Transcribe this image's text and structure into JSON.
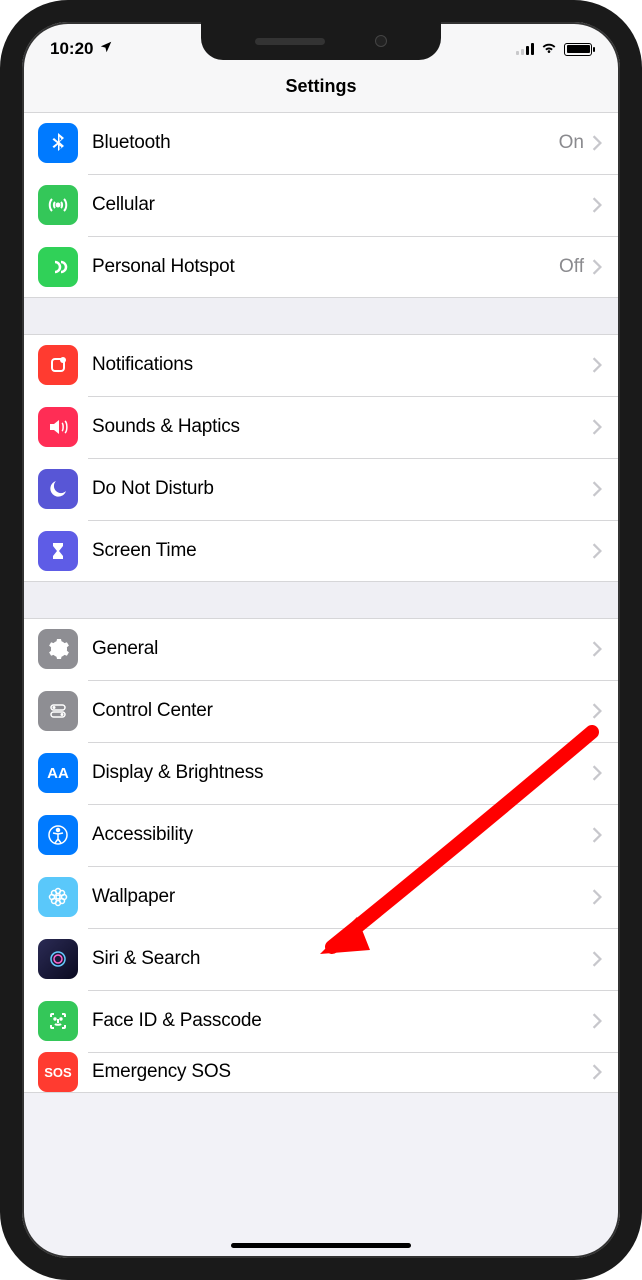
{
  "statusbar": {
    "time": "10:20"
  },
  "header": {
    "title": "Settings"
  },
  "groups": [
    {
      "rows": [
        {
          "id": "bluetooth",
          "label": "Bluetooth",
          "value": "On",
          "icon": "bluetooth",
          "color": "bg-blue"
        },
        {
          "id": "cellular",
          "label": "Cellular",
          "value": "",
          "icon": "antenna",
          "color": "bg-green"
        },
        {
          "id": "hotspot",
          "label": "Personal Hotspot",
          "value": "Off",
          "icon": "link",
          "color": "bg-green2"
        }
      ]
    },
    {
      "rows": [
        {
          "id": "notifications",
          "label": "Notifications",
          "value": "",
          "icon": "bell",
          "color": "bg-red"
        },
        {
          "id": "sounds",
          "label": "Sounds & Haptics",
          "value": "",
          "icon": "speaker",
          "color": "bg-red2"
        },
        {
          "id": "dnd",
          "label": "Do Not Disturb",
          "value": "",
          "icon": "moon",
          "color": "bg-purple"
        },
        {
          "id": "screentime",
          "label": "Screen Time",
          "value": "",
          "icon": "hourglass",
          "color": "bg-purple2"
        }
      ]
    },
    {
      "rows": [
        {
          "id": "general",
          "label": "General",
          "value": "",
          "icon": "gear",
          "color": "bg-gray"
        },
        {
          "id": "controlcenter",
          "label": "Control Center",
          "value": "",
          "icon": "switches",
          "color": "bg-gray"
        },
        {
          "id": "display",
          "label": "Display & Brightness",
          "value": "",
          "icon": "aa",
          "color": "bg-blue"
        },
        {
          "id": "accessibility",
          "label": "Accessibility",
          "value": "",
          "icon": "person",
          "color": "bg-blue"
        },
        {
          "id": "wallpaper",
          "label": "Wallpaper",
          "value": "",
          "icon": "flower",
          "color": "bg-teal"
        },
        {
          "id": "siri",
          "label": "Siri & Search",
          "value": "",
          "icon": "siri",
          "color": "bg-siri"
        },
        {
          "id": "faceid",
          "label": "Face ID & Passcode",
          "value": "",
          "icon": "faceid",
          "color": "bg-green"
        },
        {
          "id": "sos",
          "label": "Emergency SOS",
          "value": "",
          "icon": "sos",
          "color": "bg-sos"
        }
      ]
    }
  ]
}
